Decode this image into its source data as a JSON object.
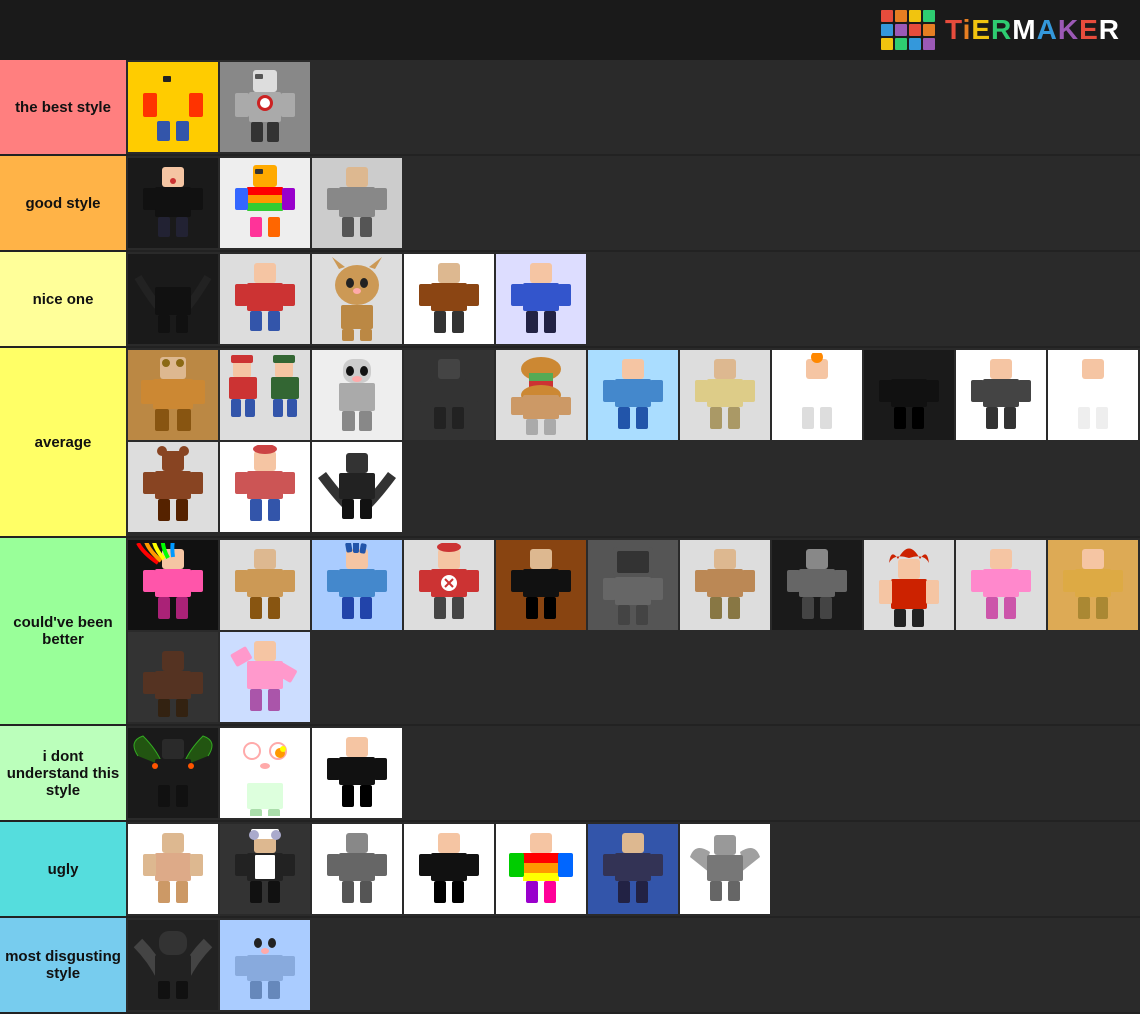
{
  "header": {
    "logo_text": "TiERMAKER",
    "logo_colors": [
      "#e74c3c",
      "#e67e22",
      "#f1c40f",
      "#2ecc71",
      "#3498db",
      "#9b59b6",
      "#e74c3c",
      "#ffffff"
    ]
  },
  "logo_cells": [
    "#e74c3c",
    "#e67e22",
    "#f1c40f",
    "#2ecc71",
    "#3498db",
    "#9b59b6",
    "#e74c3c",
    "#e67e22",
    "#f1c40f",
    "#2ecc71",
    "#3498db",
    "#9b59b6"
  ],
  "tiers": [
    {
      "id": "best",
      "label": "the best style",
      "color": "#ff7f7f",
      "items": [
        {
          "id": "b1",
          "bg": "#ffcc00",
          "desc": "yellow guy red head"
        },
        {
          "id": "b2",
          "bg": "#888888",
          "desc": "captain america roblox"
        }
      ]
    },
    {
      "id": "good",
      "label": "good style",
      "color": "#ffb347",
      "items": [
        {
          "id": "g1",
          "bg": "#222222",
          "desc": "dark character"
        },
        {
          "id": "g2",
          "bg": "#ffccff",
          "desc": "rainbow colorful"
        },
        {
          "id": "g3",
          "bg": "#dddddd",
          "desc": "gray simple"
        }
      ]
    },
    {
      "id": "nice",
      "label": "nice one",
      "color": "#ffff99",
      "items": [
        {
          "id": "n1",
          "bg": "#222222",
          "desc": "dark wings"
        },
        {
          "id": "n2",
          "bg": "#cc3333",
          "desc": "red character"
        },
        {
          "id": "n3",
          "bg": "#cc9955",
          "desc": "cat character"
        },
        {
          "id": "n4",
          "bg": "#ccaa88",
          "desc": "brown character"
        },
        {
          "id": "n5",
          "bg": "#3355cc",
          "desc": "blue character"
        }
      ]
    },
    {
      "id": "average",
      "label": "average",
      "color": "#ffff66",
      "items": [
        {
          "id": "av1",
          "bg": "#bb8844",
          "desc": "brown goggles"
        },
        {
          "id": "av2",
          "bg": "#336633",
          "desc": "green mario"
        },
        {
          "id": "av3",
          "bg": "#cccccc",
          "desc": "wolf gray"
        },
        {
          "id": "av4",
          "bg": "#444444",
          "desc": "dark character"
        },
        {
          "id": "av5",
          "bg": "#ffaa22",
          "desc": "burger character"
        },
        {
          "id": "av6",
          "bg": "#aaddff",
          "desc": "blue character"
        },
        {
          "id": "av7",
          "bg": "#ddcc88",
          "desc": "yellow character"
        },
        {
          "id": "av8",
          "bg": "#ffccaa",
          "desc": "pumpkin character"
        },
        {
          "id": "av9",
          "bg": "#222222",
          "desc": "black character"
        },
        {
          "id": "av10",
          "bg": "#444444",
          "desc": "dark girl"
        },
        {
          "id": "av11",
          "bg": "#cccccc",
          "desc": "light girl"
        },
        {
          "id": "av12",
          "bg": "#884422",
          "desc": "brown bear"
        },
        {
          "id": "av13",
          "bg": "#cc4444",
          "desc": "red hat"
        },
        {
          "id": "av14",
          "bg": "#333333",
          "desc": "dark wings 2"
        }
      ]
    },
    {
      "id": "couldhave",
      "label": "could've been better",
      "color": "#99ff99",
      "items": [
        {
          "id": "c1",
          "bg": "#ff55aa",
          "desc": "colorful rainbow"
        },
        {
          "id": "c2",
          "bg": "#cc9955",
          "desc": "brown desert"
        },
        {
          "id": "c3",
          "bg": "#4488cc",
          "desc": "blue hair"
        },
        {
          "id": "c4",
          "bg": "#cc3333",
          "desc": "red hat 2"
        },
        {
          "id": "c5",
          "bg": "#884411",
          "desc": "dark brown"
        },
        {
          "id": "c6",
          "bg": "#555555",
          "desc": "gray tv"
        },
        {
          "id": "c7",
          "bg": "#bb8855",
          "desc": "brown coffee"
        },
        {
          "id": "c8",
          "bg": "#666666",
          "desc": "gray dark"
        },
        {
          "id": "c9",
          "bg": "#ff3366",
          "desc": "red hair"
        },
        {
          "id": "c10",
          "bg": "#ff88cc",
          "desc": "pink character"
        },
        {
          "id": "c11",
          "bg": "#ddaa55",
          "desc": "yellow outfit"
        },
        {
          "id": "c12",
          "bg": "#553322",
          "desc": "dark cat"
        },
        {
          "id": "c13",
          "bg": "#dddddd",
          "desc": "anime girl dance"
        }
      ]
    },
    {
      "id": "dont",
      "label": "i dont understand this style",
      "color": "#bbffbb",
      "items": [
        {
          "id": "d1",
          "bg": "#222222",
          "desc": "dark wings colorful"
        },
        {
          "id": "d2",
          "bg": "#ddffdd",
          "desc": "hello kitty flowers"
        },
        {
          "id": "d3",
          "bg": "#cccccc",
          "desc": "black minimal"
        }
      ]
    },
    {
      "id": "ugly",
      "label": "ugly",
      "color": "#55dddd",
      "items": [
        {
          "id": "u1",
          "bg": "#ddaa88",
          "desc": "brown skin"
        },
        {
          "id": "u2",
          "bg": "#ccccdd",
          "desc": "gray maid"
        },
        {
          "id": "u3",
          "bg": "#666666",
          "desc": "gray robot"
        },
        {
          "id": "u4",
          "bg": "#ffffff",
          "desc": "white minimal"
        },
        {
          "id": "u5",
          "bg": "#ffcc88",
          "desc": "rainbow colorful 2"
        },
        {
          "id": "u6",
          "bg": "#333355",
          "desc": "dark blue"
        },
        {
          "id": "u7",
          "bg": "#888888",
          "desc": "gray winged"
        }
      ]
    },
    {
      "id": "disgusting",
      "label": "most disgusting style",
      "color": "#77ccee",
      "items": [
        {
          "id": "dis1",
          "bg": "#333333",
          "desc": "dark monster"
        },
        {
          "id": "dis2",
          "bg": "#aaccff",
          "desc": "blue cat"
        }
      ]
    }
  ]
}
